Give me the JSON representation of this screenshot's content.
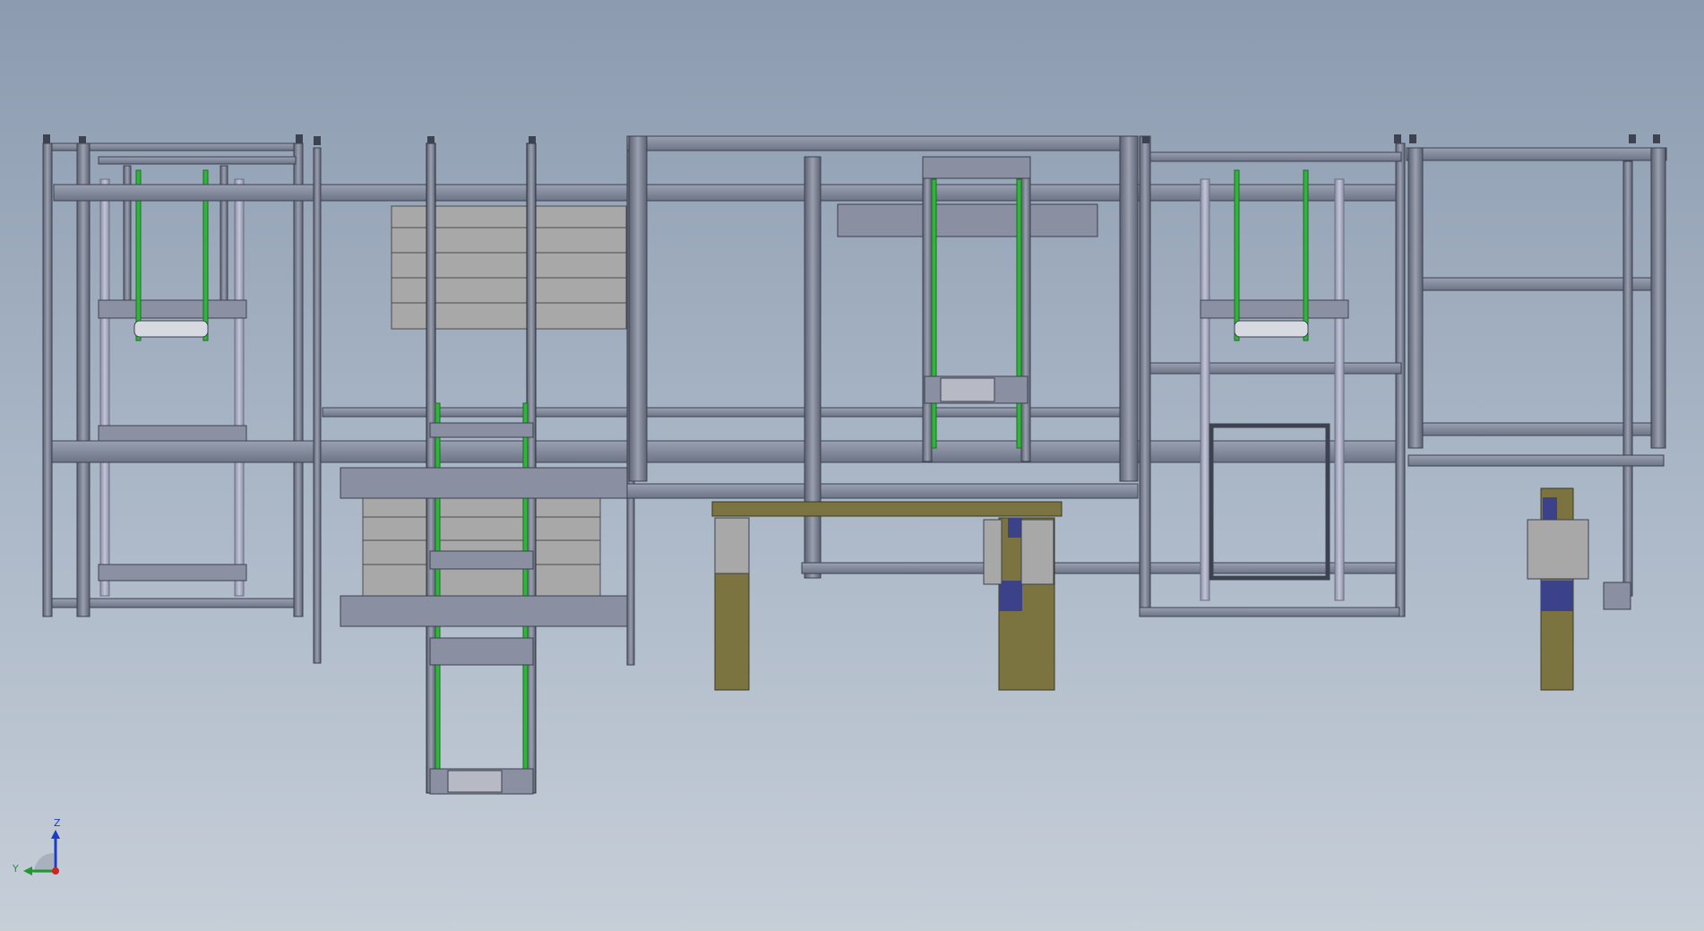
{
  "viewport": {
    "background_top": "#8c9bb0",
    "background_bottom": "#c6ced8"
  },
  "model": {
    "frame_color": "#7d8598",
    "frame_dark": "#3c4250",
    "belt_color": "#2fb53a",
    "panel_color": "#a7a8a7",
    "actuator_olive": "#7b7440",
    "actuator_blue": "#3b428a"
  },
  "triad": {
    "z_label": "Z",
    "y_label": "Y",
    "icon": "view-orientation-triad-icon",
    "z_color": "#1a3cc9",
    "y_color": "#1d9a2f",
    "x_color": "#d32222"
  }
}
